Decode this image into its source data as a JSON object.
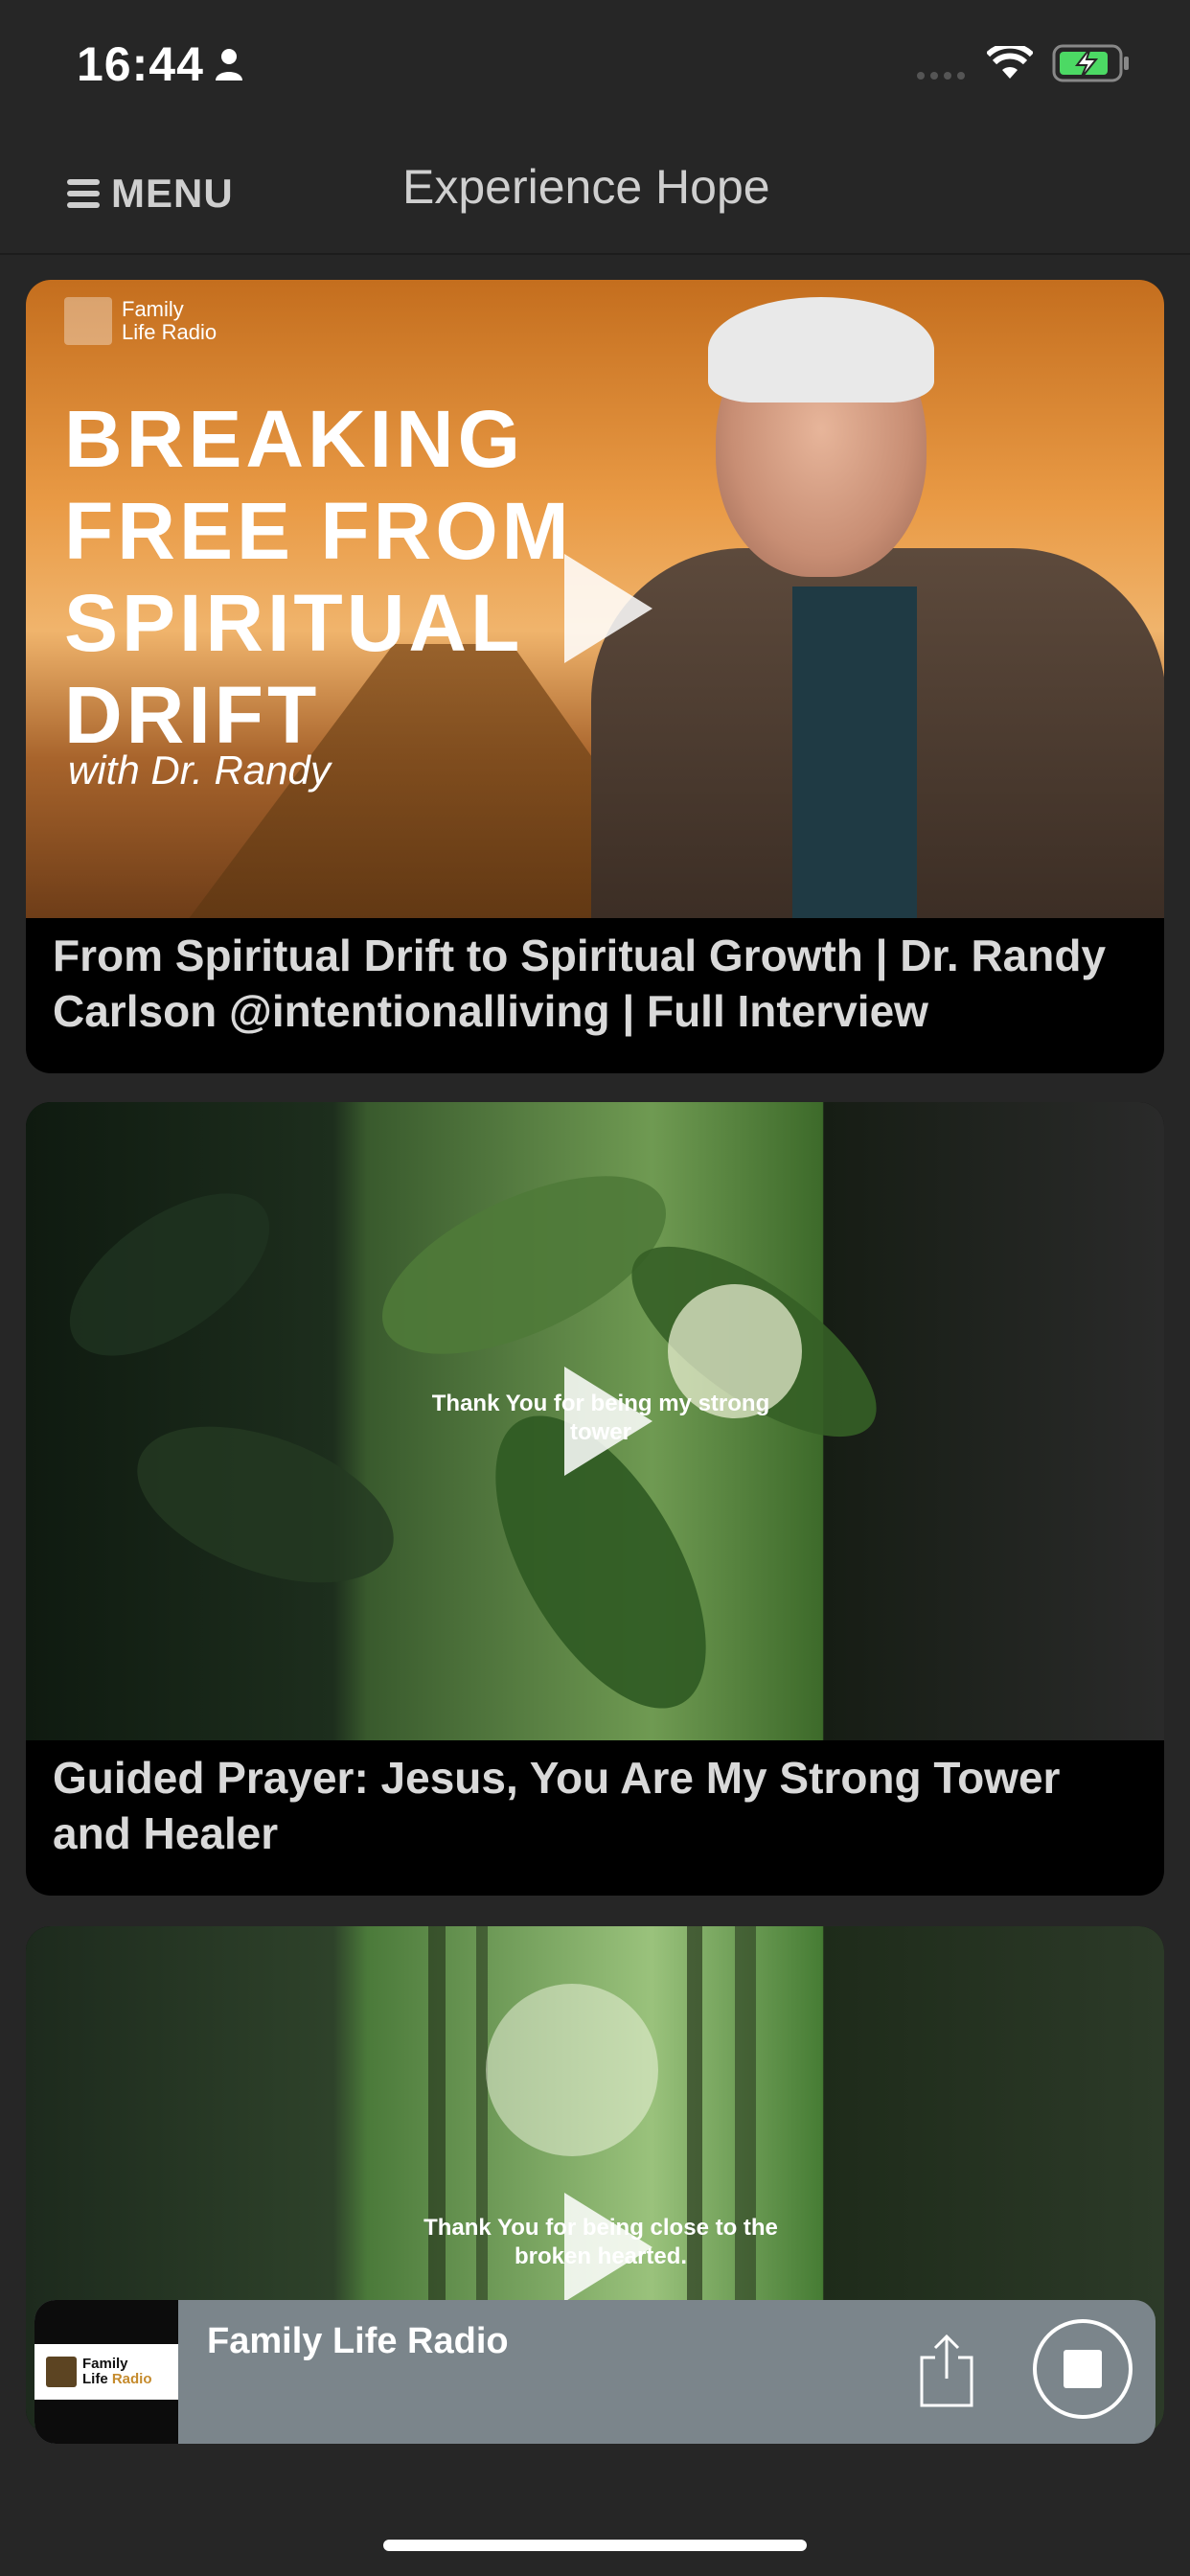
{
  "status_bar": {
    "time": "16:44",
    "icons": [
      "person-icon",
      "cellular-dots-icon",
      "wifi-icon",
      "battery-charging-icon"
    ]
  },
  "nav": {
    "menu_label": "MENU",
    "title": "Experience Hope"
  },
  "videos": [
    {
      "thumb_brand": "Family\nLife Radio",
      "thumb_headline": "BREAKING\nFREE FROM\nSPIRITUAL\nDRIFT",
      "thumb_subtitle": "with Dr. Randy",
      "title": "From Spiritual Drift to Spiritual Growth | Dr. Randy Carlson @intentionalliving  | Full Interview"
    },
    {
      "thumb_caption": "Thank You for being\nmy strong tower",
      "title": "Guided Prayer: Jesus, You Are My Strong Tower and Healer"
    },
    {
      "thumb_caption": "Thank You for being close\nto the broken hearted."
    }
  ],
  "player": {
    "logo_text_line1": "Family",
    "logo_text_line2a": "Life ",
    "logo_text_line2b": "Radio",
    "station": "Family Life Radio",
    "share_icon": "share-icon",
    "stop_icon": "stop-icon"
  },
  "colors": {
    "background": "#262626",
    "card": "#000000",
    "player": "#7b858b",
    "accent_gold": "#c58b2d"
  }
}
